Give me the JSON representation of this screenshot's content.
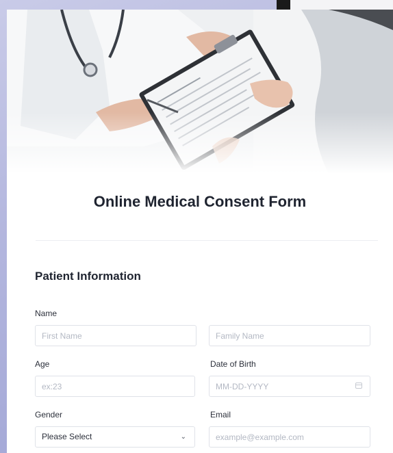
{
  "form": {
    "title": "Online Medical Consent Form",
    "section_title": "Patient Information"
  },
  "fields": {
    "name_label": "Name",
    "first_name_placeholder": "First Name",
    "family_name_placeholder": "Family Name",
    "age_label": "Age",
    "age_placeholder": "ex:23",
    "dob_label": "Date of Birth",
    "dob_placeholder": "MM-DD-YYYY",
    "gender_label": "Gender",
    "gender_value": "Please Select",
    "email_label": "Email",
    "email_placeholder": "example@example.com"
  },
  "icons": {
    "select_chevron": "chevron-down-icon",
    "date_picker": "calendar-icon"
  },
  "colors": {
    "background": "#b3b6de",
    "card": "#ffffff",
    "title_text": "#1f2430",
    "field_border": "#dfe2e8",
    "placeholder": "#b3b8c3"
  }
}
